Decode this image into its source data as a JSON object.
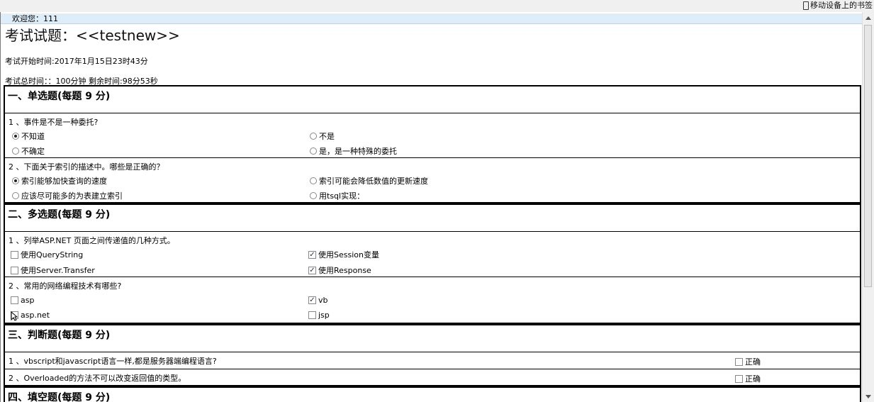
{
  "browser": {
    "bookmark": "移动设备上的书签"
  },
  "welcome": "欢迎您：111",
  "exam": {
    "title": "考试试题：<<testnew>>",
    "start_time": "考试开始时间:2017年1月15日23时43分",
    "duration": "考试总时间：：100分钟 剩余时间:98分53秒"
  },
  "sections": {
    "single": {
      "heading": "一、单选题(每题 9 分)",
      "questions": [
        {
          "text": "1 、事件是不是一种委托?",
          "options": [
            {
              "label": "不知道",
              "checked": true
            },
            {
              "label": "不是",
              "checked": false
            },
            {
              "label": "不确定",
              "checked": false
            },
            {
              "label": "是，是一种特殊的委托",
              "checked": false
            }
          ]
        },
        {
          "text": "2 、下面关于索引的描述中。哪些是正确的？",
          "options": [
            {
              "label": "索引能够加快查询的速度",
              "checked": true
            },
            {
              "label": "索引可能会降低数值的更新速度",
              "checked": false
            },
            {
              "label": "应该尽可能多的为表建立索引",
              "checked": false
            },
            {
              "label": "用tsql实现：",
              "checked": false
            }
          ]
        }
      ]
    },
    "multi": {
      "heading": "二、多选题(每题 9 分)",
      "questions": [
        {
          "text": "1 、列举ASP.NET 页面之间传递值的几种方式。",
          "options": [
            {
              "label": "使用QueryString",
              "checked": false
            },
            {
              "label": "使用Session变量",
              "checked": true
            },
            {
              "label": "使用Server.Transfer",
              "checked": false
            },
            {
              "label": "使用Response",
              "checked": true
            }
          ]
        },
        {
          "text": "2 、常用的网络编程技术有哪些?",
          "options": [
            {
              "label": "asp",
              "checked": false
            },
            {
              "label": "vb",
              "checked": true
            },
            {
              "label": "asp.net",
              "checked": false
            },
            {
              "label": "jsp",
              "checked": false
            }
          ]
        }
      ]
    },
    "judge": {
      "heading": "三、判断题(每题 9 分)",
      "questions": [
        {
          "text": "1 、vbscript和javascript语言一样,都是服务器端编程语言?",
          "option": "正确",
          "checked": false
        },
        {
          "text": "2 、Overloaded的方法不可以改变返回值的类型。",
          "option": "正确",
          "checked": false
        }
      ]
    },
    "fill": {
      "heading": "四、填空题(每题 9 分)"
    }
  }
}
